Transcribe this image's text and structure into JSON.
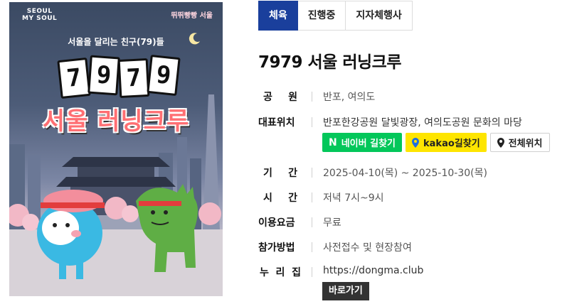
{
  "poster": {
    "brand_left_line1": "SEOUL",
    "brand_left_line2": "MY SOUL",
    "brand_right": "뛰뛰빵빵 서울",
    "subtitle": "서울을 달리는 친구(79)들",
    "digits": [
      "7",
      "9",
      "7",
      "9"
    ],
    "title": "서울 러닝크루"
  },
  "tabs": [
    {
      "label": "체육",
      "active": true
    },
    {
      "label": "진행중",
      "active": false
    },
    {
      "label": "지자체행사",
      "active": false
    }
  ],
  "event": {
    "title": "7979 서울 러닝크루",
    "park_label": [
      "공",
      "원"
    ],
    "park": "반포, 여의도",
    "location_label": "대표위치",
    "location": "반포한강공원 달빛광장, 여의도공원 문화의 마당",
    "period_label": [
      "기",
      "간"
    ],
    "period": "2025-04-10(목) ~ 2025-10-30(목)",
    "time_label": [
      "시",
      "간"
    ],
    "time": "저녁 7시~9시",
    "fee_label": "이용요금",
    "fee": "무료",
    "method_label": "참가방법",
    "method": "사전접수 및 현장참여",
    "homepage_label": [
      "누",
      "리",
      "집"
    ],
    "homepage": "https://dongma.club"
  },
  "buttons": {
    "naver_icon": "N",
    "naver": "네이버 길찾기",
    "kakao": "kakao길찾기",
    "all": "전체위치",
    "goto": "바로가기"
  },
  "colors": {
    "tab_active": "#1a3f9c",
    "naver": "#03c75a",
    "kakao": "#fee500",
    "goto": "#333333"
  }
}
